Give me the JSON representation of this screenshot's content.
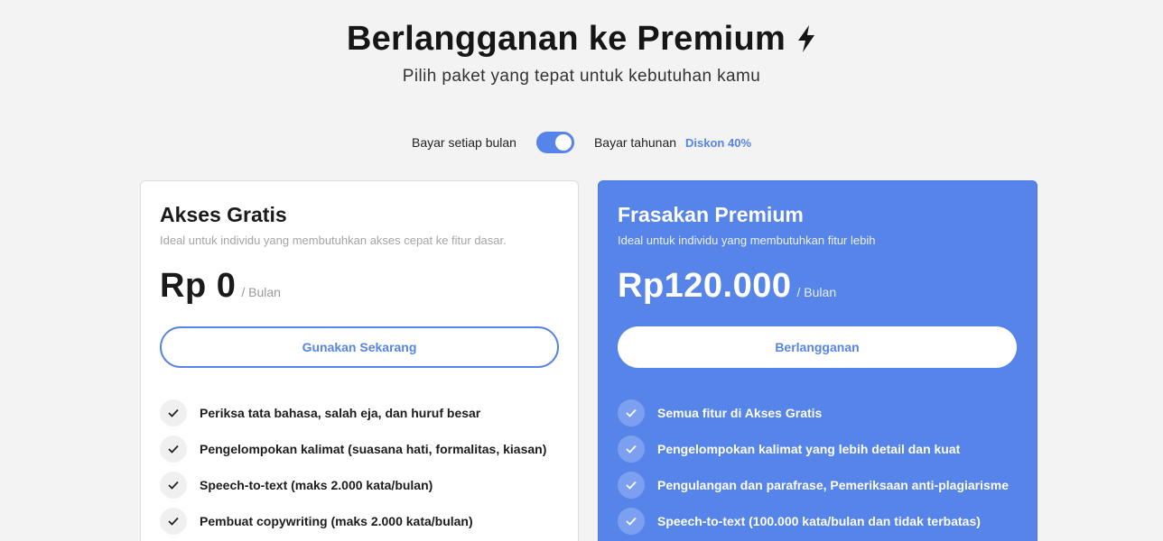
{
  "header": {
    "title": "Berlangganan ke Premium",
    "subtitle": "Pilih paket yang tepat untuk kebutuhan kamu",
    "title_icon": "lightning-bolt-icon"
  },
  "billing": {
    "monthly_label": "Bayar setiap bulan",
    "yearly_label": "Bayar tahunan",
    "discount_label": "Diskon 40%",
    "toggle_state": "yearly"
  },
  "colors": {
    "accent": "#5684e8",
    "background": "#f3f3f3",
    "card_free": "#ffffff"
  },
  "plans": {
    "free": {
      "name": "Akses Gratis",
      "description": "Ideal untuk individu yang membutuhkan akses cepat ke fitur dasar.",
      "price": "Rp 0",
      "period": "/ Bulan",
      "cta": "Gunakan Sekarang",
      "features": [
        "Periksa tata bahasa, salah eja, dan huruf besar",
        "Pengelompokan kalimat (suasana hati, formalitas, kiasan)",
        "Speech-to-text (maks 2.000 kata/bulan)",
        "Pembuat copywriting (maks 2.000 kata/bulan)"
      ]
    },
    "premium": {
      "name": "Frasakan Premium",
      "description": "Ideal untuk individu yang membutuhkan fitur lebih",
      "price": "Rp120.000",
      "period": "/ Bulan",
      "cta": "Berlangganan",
      "features": [
        "Semua fitur di Akses Gratis",
        "Pengelompokan kalimat yang lebih detail dan kuat",
        "Pengulangan dan parafrase, Pemeriksaan anti-plagiarisme",
        "Speech-to-text (100.000 kata/bulan dan tidak terbatas)"
      ]
    }
  }
}
